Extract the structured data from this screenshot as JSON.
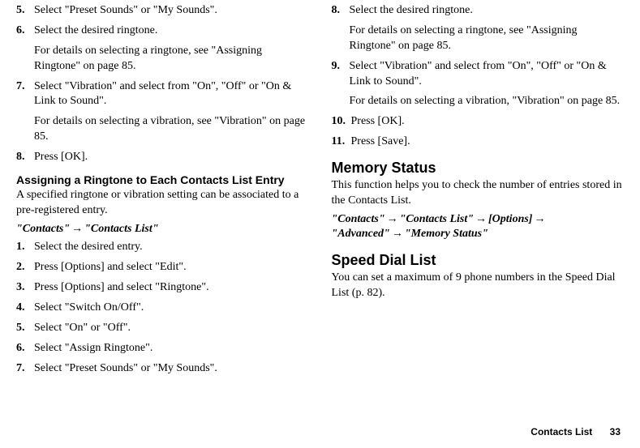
{
  "left": {
    "i5": {
      "n": "5.",
      "t": "Select \"Preset Sounds\" or \"My Sounds\"."
    },
    "i6": {
      "n": "6.",
      "t": "Select the desired ringtone."
    },
    "i6b": "For details on selecting a ringtone, see \"Assigning Ringtone\" on page 85.",
    "i7": {
      "n": "7.",
      "t": "Select \"Vibration\" and select from \"On\", \"Off\" or \"On & Link to Sound\"."
    },
    "i7b": "For details on selecting a vibration, see \"Vibration\" on page 85.",
    "i8": {
      "n": "8.",
      "t": "Press [OK]."
    },
    "sec1_title": "Assigning a Ringtone to Each Contacts List Entry",
    "sec1_desc": "A specified ringtone or vibration setting can be associated to a pre-registered entry.",
    "sec1_path_a": "\"Contacts\"",
    "sec1_path_b": "\"Contacts List\"",
    "arrow": "→",
    "s1": {
      "n": "1.",
      "t": "Select the desired entry."
    },
    "s2": {
      "n": "2.",
      "t": "Press [Options] and select \"Edit\"."
    },
    "s3": {
      "n": "3.",
      "t": "Press [Options] and select \"Ringtone\"."
    },
    "s4": {
      "n": "4.",
      "t": "Select \"Switch On/Off\"."
    },
    "s5": {
      "n": "5.",
      "t": "Select \"On\" or \"Off\"."
    },
    "s6": {
      "n": "6.",
      "t": "Select \"Assign Ringtone\"."
    },
    "s7": {
      "n": "7.",
      "t": "Select \"Preset Sounds\" or \"My Sounds\"."
    }
  },
  "right": {
    "i8": {
      "n": "8.",
      "t": "Select the desired ringtone."
    },
    "i8b": "For details on selecting a ringtone, see \"Assigning Ringtone\" on page 85.",
    "i9": {
      "n": "9.",
      "t": "Select \"Vibration\" and select from \"On\", \"Off\" or \"On & Link to Sound\"."
    },
    "i9b": "For details on selecting a vibration, \"Vibration\" on page 85.",
    "i10": {
      "n": "10.",
      "t": "Press [OK]."
    },
    "i11": {
      "n": "11.",
      "t": "Press [Save]."
    },
    "mem_title": "Memory Status",
    "mem_desc": "This function helps you to check the number of entries stored in the Contacts List.",
    "mem_path_a": "\"Contacts\"",
    "mem_path_b": "\"Contacts List\"",
    "mem_path_c": "[Options]",
    "mem_path_d": "\"Advanced\"",
    "mem_path_e": "\"Memory Status\"",
    "arrow": "→",
    "sdl_title": "Speed Dial List",
    "sdl_desc": "You can set a maximum of 9 phone numbers in the Speed Dial List (p. 82)."
  },
  "footer": {
    "label": "Contacts List",
    "page": "33"
  }
}
